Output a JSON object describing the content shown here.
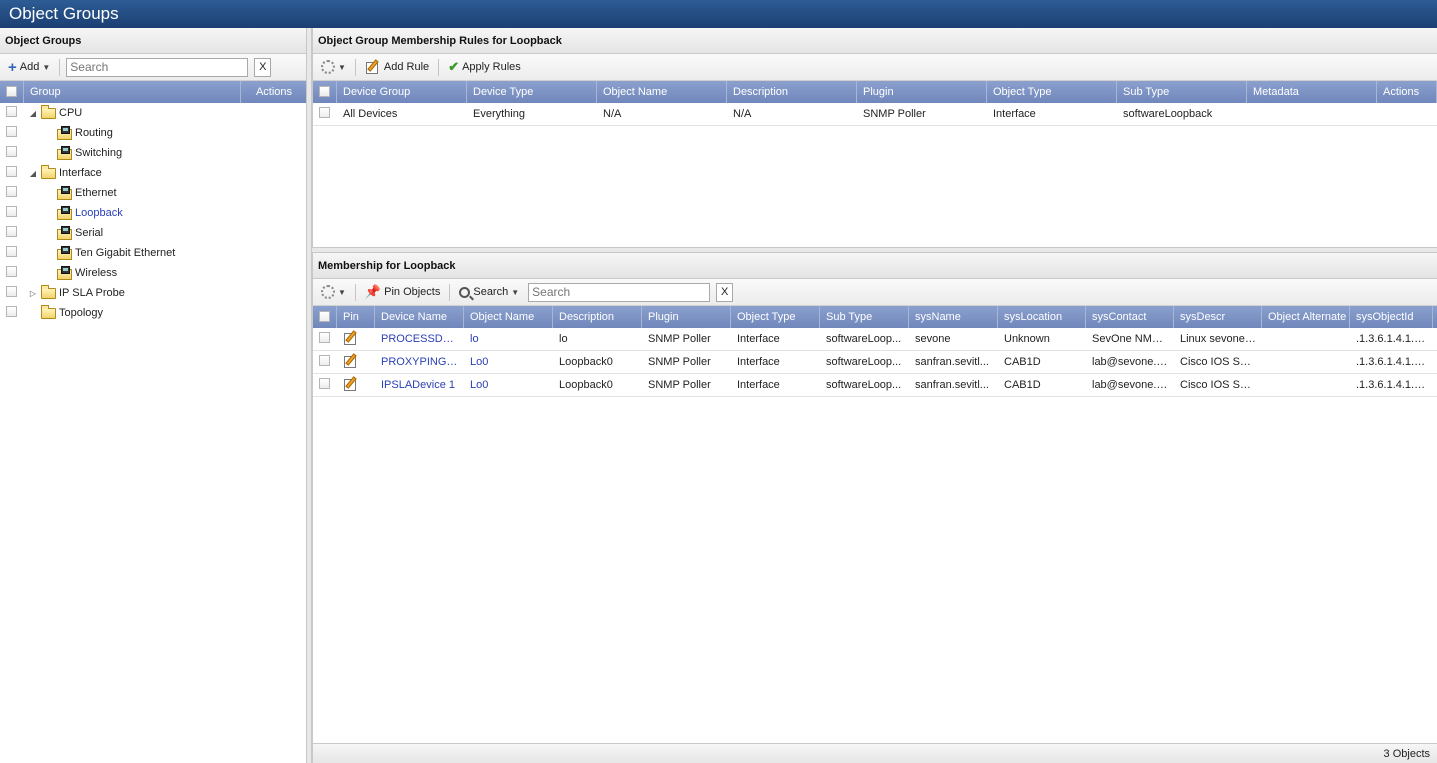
{
  "app": {
    "title": "Object Groups"
  },
  "left": {
    "header": "Object Groups",
    "add_label": "Add",
    "search_placeholder": "Search",
    "clear_label": "X",
    "columns": {
      "group": "Group",
      "actions": "Actions"
    },
    "tree": [
      {
        "label": "CPU",
        "level": 0,
        "type": "folder",
        "expanded": true
      },
      {
        "label": "Routing",
        "level": 1,
        "type": "group"
      },
      {
        "label": "Switching",
        "level": 1,
        "type": "group"
      },
      {
        "label": "Interface",
        "level": 0,
        "type": "folder",
        "expanded": true
      },
      {
        "label": "Ethernet",
        "level": 1,
        "type": "group"
      },
      {
        "label": "Loopback",
        "level": 1,
        "type": "group",
        "selected": true
      },
      {
        "label": "Serial",
        "level": 1,
        "type": "group"
      },
      {
        "label": "Ten Gigabit Ethernet",
        "level": 1,
        "type": "group"
      },
      {
        "label": "Wireless",
        "level": 1,
        "type": "group"
      },
      {
        "label": "IP SLA Probe",
        "level": 0,
        "type": "folder",
        "expanded": false
      },
      {
        "label": "Topology",
        "level": 0,
        "type": "folder",
        "leaf": true
      }
    ]
  },
  "rules": {
    "header": "Object Group Membership Rules for Loopback",
    "add_rule_label": "Add Rule",
    "apply_rules_label": "Apply Rules",
    "columns": [
      "Device Group",
      "Device Type",
      "Object Name",
      "Description",
      "Plugin",
      "Object Type",
      "Sub Type",
      "Metadata",
      "Actions"
    ],
    "rows": [
      [
        "All Devices",
        "Everything",
        "N/A",
        "N/A",
        "SNMP Poller",
        "Interface",
        "softwareLoopback",
        "",
        ""
      ]
    ]
  },
  "membership": {
    "header": "Membership for Loopback",
    "pin_objects_label": "Pin Objects",
    "search_label": "Search",
    "search_placeholder": "Search",
    "clear_label": "X",
    "columns": [
      "Pin",
      "Device Name",
      "Object Name",
      "Description",
      "Plugin",
      "Object Type",
      "Sub Type",
      "sysName",
      "sysLocation",
      "sysContact",
      "sysDescr",
      "Object Alternate",
      "sysObjectId"
    ],
    "rows": [
      [
        "",
        "PROCESSDevi...",
        "lo",
        "lo",
        "SNMP Poller",
        "Interface",
        "softwareLoop...",
        "sevone",
        "Unknown",
        "SevOne NMS ...",
        "Linux sevone ...",
        "",
        ".1.3.6.1.4.1.8..."
      ],
      [
        "",
        "PROXYPINGD...",
        "Lo0",
        "Loopback0",
        "SNMP Poller",
        "Interface",
        "softwareLoop...",
        "sanfran.sevitl...",
        "CAB1D",
        "lab@sevone.c...",
        "Cisco IOS Sof...",
        "",
        ".1.3.6.1.4.1.9..."
      ],
      [
        "",
        "IPSLADevice 1",
        "Lo0",
        "Loopback0",
        "SNMP Poller",
        "Interface",
        "softwareLoop...",
        "sanfran.sevitl...",
        "CAB1D",
        "lab@sevone.c...",
        "Cisco IOS Sof...",
        "",
        ".1.3.6.1.4.1.9..."
      ]
    ],
    "footer_count": "3 Objects"
  }
}
